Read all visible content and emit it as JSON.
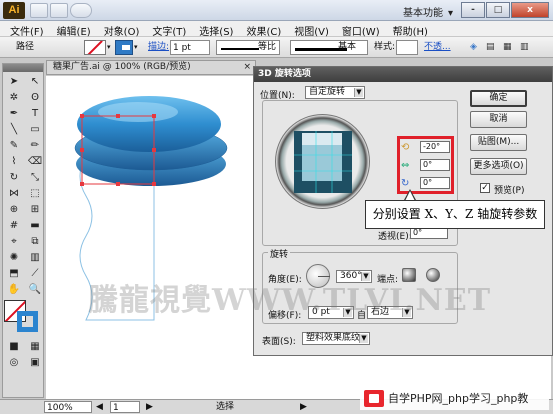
{
  "app": {
    "logo": "Ai",
    "workspace": "基本功能"
  },
  "window_buttons": [
    "-",
    "□",
    "x"
  ],
  "menu": [
    "文件(F)",
    "编辑(E)",
    "对象(O)",
    "文字(T)",
    "选择(S)",
    "效果(C)",
    "视图(V)",
    "窗口(W)",
    "帮助(H)"
  ],
  "control": {
    "object_type": "路径",
    "stroke_link": "描边:",
    "stroke_weight": "1 pt",
    "profile_label": "等比",
    "brush_label": "基本",
    "style_label": "样式:",
    "opacity_link": "不透..."
  },
  "document": {
    "tab_title": "糖果广告.ai @ 100% (RGB/预览)"
  },
  "dialog": {
    "title": "3D 旋转选项",
    "position_label": "位置(N):",
    "position_value": "自定旋转",
    "x_angle": "-20°",
    "y_angle": "0°",
    "z_angle": "0°",
    "perspective_label": "透视(E):",
    "perspective_value": "0°",
    "rotate_section": "旋转",
    "angle_label": "角度(E):",
    "angle_value": "360°",
    "cap_label": "端点:",
    "offset_label": "偏移(F):",
    "offset_value": "0 pt",
    "offset_from": "自",
    "offset_side": "右边",
    "surface_label": "表面(S):",
    "surface_value": "塑料效果底纹",
    "buttons": {
      "ok": "确定",
      "cancel": "取消",
      "map": "贴图(M)...",
      "more": "更多选项(O)"
    },
    "preview_label": "预览(P)",
    "preview_checked": "✓"
  },
  "callout": "分别设置 X、Y、Z 轴旋转参数",
  "status": {
    "zoom": "100%",
    "page": "1",
    "mode": "选择"
  },
  "watermark": "騰龍視覺WWW.TLVI.NET",
  "php_badge": "自学PHP网_php学习_php教",
  "colors": {
    "accent_blue": "#2b84cf",
    "highlight_red": "#e0202a"
  }
}
